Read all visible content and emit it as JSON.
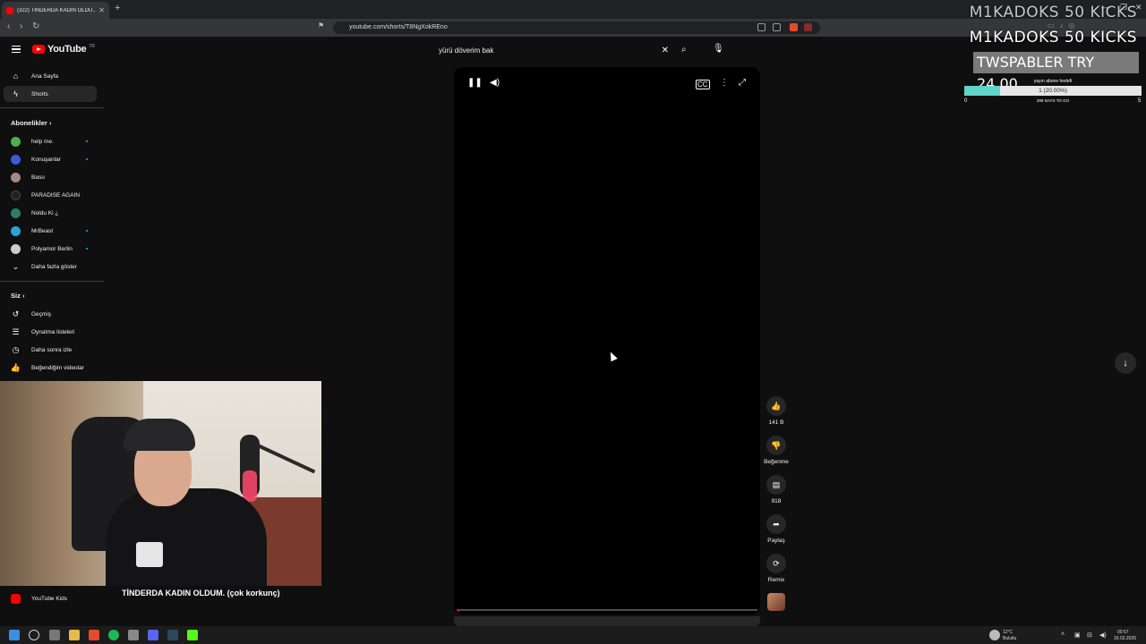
{
  "browser": {
    "tab_title": "(322) TİNDERDA KADIN OLDU...",
    "url": "youtube.com/shorts/T8NgXokREno"
  },
  "youtube": {
    "logo_text": "YouTube",
    "logo_country": "TR",
    "search_value": "yürü döverim bak"
  },
  "sidebar": {
    "main": [
      {
        "label": "Ana Sayfa",
        "icon": "home-icon"
      },
      {
        "label": "Shorts",
        "icon": "shorts-icon"
      }
    ],
    "subscriptions_title": "Abonelikler",
    "subscriptions": [
      {
        "label": "help me.",
        "color": "#4caf50",
        "dot": true
      },
      {
        "label": "Konuşanlar",
        "color": "#3b5bdb",
        "dot": true
      },
      {
        "label": "Baso",
        "color": "#9e8c80",
        "dot": false
      },
      {
        "label": "PARADISE AGAIN",
        "color": "#222222",
        "dot": false
      },
      {
        "label": "Noldu Ki ¿",
        "color": "#2e7d6b",
        "dot": false
      },
      {
        "label": "MrBeast",
        "color": "#29a3d6",
        "dot": true
      },
      {
        "label": "Polyamor Berlin",
        "color": "#cccccc",
        "dot": true
      }
    ],
    "show_more": "Daha fazla göster",
    "you_title": "Siz",
    "you_items": [
      {
        "label": "Geçmiş",
        "icon": "history-icon"
      },
      {
        "label": "Oynatma listeleri",
        "icon": "playlists-icon"
      },
      {
        "label": "Daha sonra izle",
        "icon": "watch-later-icon"
      },
      {
        "label": "Beğendiğim videolar",
        "icon": "liked-videos-icon"
      }
    ],
    "youtube_kids": "YouTube Kids"
  },
  "stream": {
    "caption": "TİNDERDA KADIN OLDUM. (çok korkunç)",
    "kick_line1": "M1KADOKS  50 KICKS",
    "kick_line2": "M1KADOKS  50 KICKS",
    "donation": "TWSPABLER  TRY 24.00",
    "goal_title": "yayın abone hedefi",
    "goal_value": "1 (20.00%)",
    "goal_fraction": 0.2,
    "goal_min": "0",
    "goal_max": "5",
    "goal_days": "299 DAYS TO GO"
  },
  "player": {
    "progress": 0.01
  },
  "actions": {
    "likes": "141 B",
    "dislike": "Beğenme",
    "comments": "918",
    "share": "Paylaş",
    "remix": "Remix"
  },
  "taskbar": {
    "weather_temp": "12°C",
    "weather_desc": "Bulutlu",
    "time": "00:57",
    "date": "16.02.2026"
  },
  "colors": {
    "background": "#0f0f0f",
    "accent": "#ff0000"
  }
}
